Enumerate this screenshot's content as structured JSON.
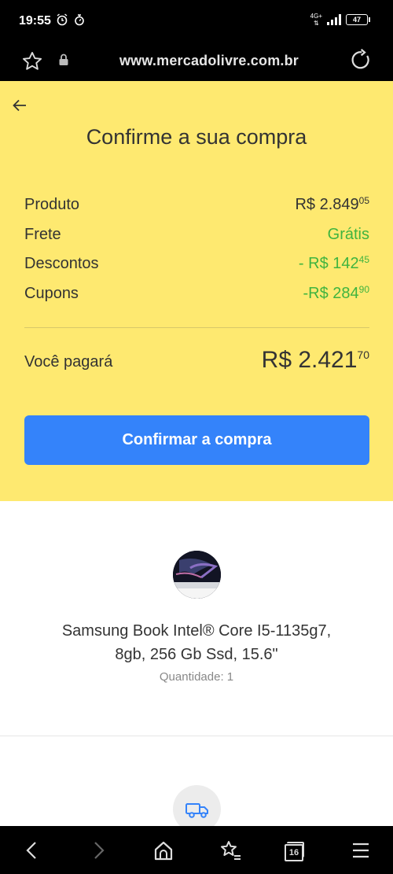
{
  "status_bar": {
    "time": "19:55",
    "network": "4G+",
    "battery": "47"
  },
  "browser": {
    "url": "www.mercadolivre.com.br",
    "tab_count": "16"
  },
  "checkout": {
    "title": "Confirme a sua compra",
    "rows": [
      {
        "label": "Produto",
        "value_main": "R$ 2.849",
        "value_cents": "05",
        "green": false
      },
      {
        "label": "Frete",
        "value_main": "Grátis",
        "value_cents": "",
        "green": true
      },
      {
        "label": "Descontos",
        "value_main": "- R$ 142",
        "value_cents": "45",
        "green": true
      },
      {
        "label": "Cupons",
        "value_main": "-R$ 284",
        "value_cents": "90",
        "green": true
      }
    ],
    "total_label": "Você pagará",
    "total_main": "R$ 2.421",
    "total_cents": "70",
    "confirm_label": "Confirmar a compra"
  },
  "product": {
    "name_line1": "Samsung Book Intel® Core I5-1135g7,",
    "name_line2": "8gb, 256 Gb Ssd, 15.6\"",
    "quantity": "Quantidade: 1"
  },
  "colors": {
    "yellow_bg": "#fee970",
    "button_blue": "#3483fa",
    "green": "#3fb43f"
  }
}
